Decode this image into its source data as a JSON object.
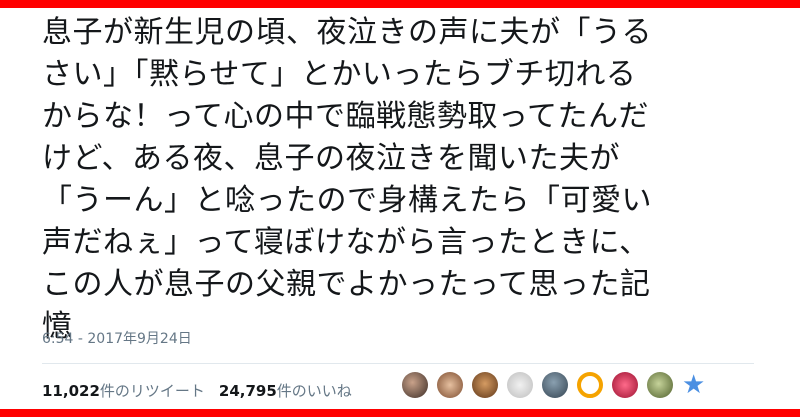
{
  "tweet": {
    "lines": [
      "息子が新生児の頃、夜泣きの声に夫が「うる",
      "さい」「黙らせて」とかいったらブチ切れる",
      "からな！って心の中で臨戦態勢取ってたんだ",
      "けど、ある夜、息子の夜泣きを聞いた夫が",
      "「うーん」と唸ったので身構えたら「可愛い",
      "声だねぇ」って寝ぼけながら言ったときに、",
      "この人が息子の父親でよかったって思った記",
      "憶"
    ],
    "timestamp": "6:54 - 2017年9月24日"
  },
  "stats": {
    "retweet_count": "11,022",
    "retweet_label": "件のリツイート",
    "like_count": "24,795",
    "like_label": "件のいいね"
  },
  "colors": {
    "frame": "#ff0000",
    "text": "#14171a",
    "muted": "#657786"
  },
  "avatars": [
    "avatar-1",
    "avatar-2",
    "avatar-3",
    "avatar-4",
    "avatar-5",
    "avatar-6",
    "avatar-7",
    "avatar-8",
    "star-icon"
  ]
}
